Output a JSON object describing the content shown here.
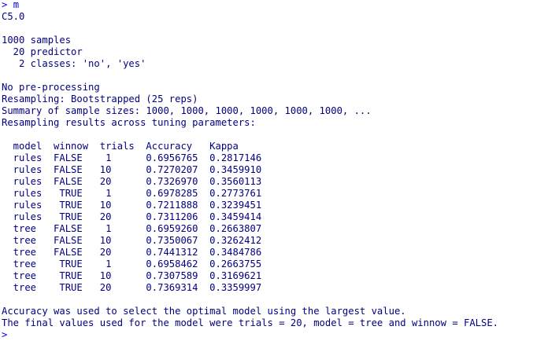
{
  "console": {
    "prompt": ">",
    "command": "m",
    "output_lines": [
      "C5.0",
      "",
      "1000 samples",
      "  20 predictor",
      "   2 classes: 'no', 'yes'",
      "",
      "No pre-processing",
      "Resampling: Bootstrapped (25 reps)",
      "Summary of sample sizes: 1000, 1000, 1000, 1000, 1000, 1000, ...",
      "Resampling results across tuning parameters:",
      "",
      "  model  winnow  trials  Accuracy   Kappa",
      "  rules  FALSE    1      0.6956765  0.2817146",
      "  rules  FALSE   10      0.7270207  0.3459910",
      "  rules  FALSE   20      0.7326970  0.3560113",
      "  rules   TRUE    1      0.6978285  0.2773761",
      "  rules   TRUE   10      0.7211888  0.3239451",
      "  rules   TRUE   20      0.7311206  0.3459414",
      "  tree   FALSE    1      0.6959260  0.2663807",
      "  tree   FALSE   10      0.7350067  0.3262412",
      "  tree   FALSE   20      0.7441312  0.3484786",
      "  tree    TRUE    1      0.6958462  0.2663755",
      "  tree    TRUE   10      0.7307589  0.3169621",
      "  tree    TRUE   20      0.7369314  0.3359997",
      "",
      "Accuracy was used to select the optimal model using the largest value.",
      "The final values used for the model were trials = 20, model = tree and winnow = FALSE."
    ],
    "next_prompt": ">"
  },
  "colors": {
    "background": "#ffffff",
    "output_text": "#000080",
    "command_text": "#0000ff"
  }
}
